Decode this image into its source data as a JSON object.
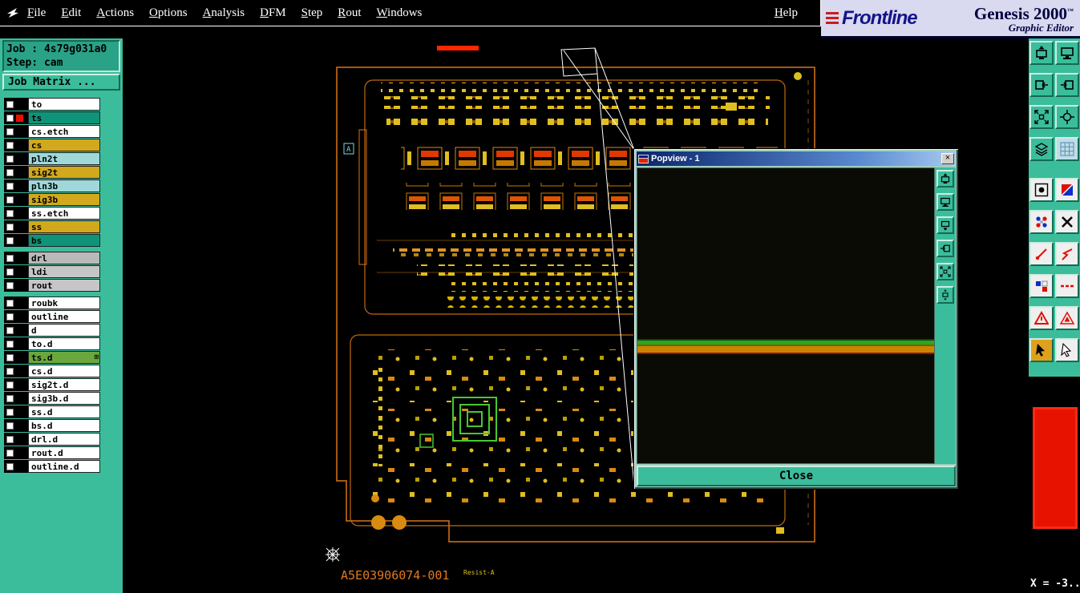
{
  "menubar": {
    "items": [
      {
        "label": "File",
        "underline": 0
      },
      {
        "label": "Edit",
        "underline": 0
      },
      {
        "label": "Actions",
        "underline": 0
      },
      {
        "label": "Options",
        "underline": 0
      },
      {
        "label": "Analysis",
        "underline": 0
      },
      {
        "label": "DFM",
        "underline": 0
      },
      {
        "label": "Step",
        "underline": 0
      },
      {
        "label": "Rout",
        "underline": 0
      },
      {
        "label": "Windows",
        "underline": 0
      }
    ],
    "help": {
      "label": "Help",
      "underline": 0
    }
  },
  "brand": {
    "name": "Frontline",
    "product": "Genesis 2000",
    "trademark": "™",
    "subtitle": "Graphic Editor"
  },
  "sidebar": {
    "job_label": "Job : 4s79g031a0",
    "step_label": "Step: cam",
    "job_matrix": "Job Matrix ...",
    "layer_groups": [
      {
        "rows": [
          {
            "name": "to",
            "bg": "#ffffff"
          },
          {
            "name": "ts",
            "bg": "#0e9478",
            "selected": true
          },
          {
            "name": "cs.etch",
            "bg": "#ffffff"
          },
          {
            "name": "cs",
            "bg": "#d2a81c"
          },
          {
            "name": "pln2t",
            "bg": "#9fd8d8"
          },
          {
            "name": "sig2t",
            "bg": "#d2a81c"
          },
          {
            "name": "pln3b",
            "bg": "#9fd8d8"
          },
          {
            "name": "sig3b",
            "bg": "#d2a81c"
          },
          {
            "name": "ss.etch",
            "bg": "#ffffff"
          },
          {
            "name": "ss",
            "bg": "#d2a81c"
          },
          {
            "name": "bs",
            "bg": "#0e9478"
          }
        ]
      },
      {
        "rows": [
          {
            "name": "drl",
            "bg": "#b9b9b9"
          },
          {
            "name": "ldi",
            "bg": "#c6c6c6"
          },
          {
            "name": "rout",
            "bg": "#c6c6c6"
          }
        ]
      },
      {
        "rows": [
          {
            "name": "roubk",
            "bg": "#ffffff"
          },
          {
            "name": "outline",
            "bg": "#ffffff"
          },
          {
            "name": "d",
            "bg": "#ffffff"
          },
          {
            "name": "to.d",
            "bg": "#ffffff"
          },
          {
            "name": "ts.d",
            "bg": "#6aa83e",
            "grid_icon": true
          },
          {
            "name": "cs.d",
            "bg": "#ffffff"
          },
          {
            "name": "sig2t.d",
            "bg": "#ffffff"
          },
          {
            "name": "sig3b.d",
            "bg": "#ffffff"
          },
          {
            "name": "ss.d",
            "bg": "#ffffff"
          },
          {
            "name": "bs.d",
            "bg": "#ffffff"
          },
          {
            "name": "drl.d",
            "bg": "#ffffff"
          },
          {
            "name": "rout.d",
            "bg": "#ffffff"
          },
          {
            "name": "outline.d",
            "bg": "#ffffff"
          }
        ]
      }
    ]
  },
  "canvas": {
    "board_id": "A5E03906074-001",
    "resist_label": "Resist-A",
    "corner_marker": "A"
  },
  "popview": {
    "title": "Popview - 1",
    "close_x": "×",
    "close_button": "Close",
    "side_buttons": [
      {
        "icon": "screen-up"
      },
      {
        "icon": "screen"
      },
      {
        "icon": "screen-down"
      },
      {
        "icon": "screen-in-right"
      },
      {
        "icon": "fit-all"
      },
      {
        "icon": "fit-v"
      }
    ]
  },
  "toolbar_right": {
    "buttons": [
      {
        "icon": "screen-up",
        "face": "teal"
      },
      {
        "icon": "screen",
        "face": "teal"
      },
      {
        "icon": "screen-in-left",
        "face": "teal"
      },
      {
        "icon": "screen-in-right",
        "face": "teal"
      },
      {
        "icon": "fit-all",
        "face": "teal"
      },
      {
        "icon": "zoom-center",
        "face": "teal"
      },
      {
        "icon": "layers",
        "face": "teal"
      },
      {
        "icon": "grid",
        "face": "light"
      },
      {
        "icon": "dot-square",
        "face": "white"
      },
      {
        "icon": "red-blue-split",
        "face": "white"
      },
      {
        "icon": "net-points",
        "face": "white"
      },
      {
        "icon": "cross-x",
        "face": "white"
      },
      {
        "icon": "measure-diag",
        "face": "white"
      },
      {
        "icon": "measure-flash",
        "face": "white"
      },
      {
        "icon": "small-squares",
        "face": "white"
      },
      {
        "icon": "dash-line",
        "face": "white"
      },
      {
        "icon": "triangle-alert",
        "face": "white"
      },
      {
        "icon": "triangle-outline",
        "face": "white"
      },
      {
        "icon": "cursor-black",
        "face": "gold"
      },
      {
        "icon": "cursor-white",
        "face": "white"
      }
    ]
  },
  "status": {
    "coords": "X = -3.."
  }
}
